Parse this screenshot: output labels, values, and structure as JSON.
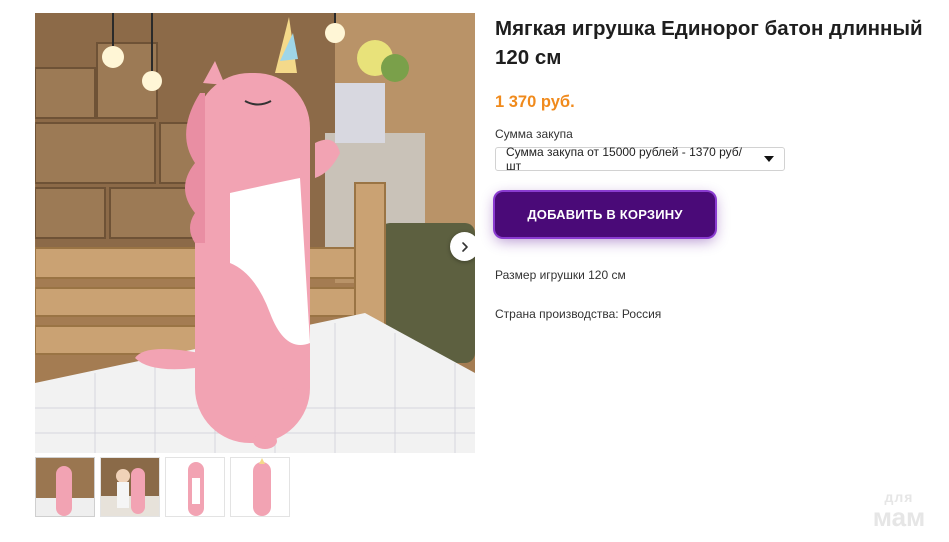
{
  "product": {
    "title": "Мягкая игрушка Единорог батон длинный 120 см",
    "price": "1 370 руб.",
    "purchase_label": "Сумма закупа",
    "purchase_selected": "Сумма закупа от 15000 рублей - 1370 руб/шт",
    "add_to_cart": "ДОБАВИТЬ В КОРЗИНУ",
    "spec_size": "Размер игрушки 120 см",
    "spec_country": "Страна производства: Россия"
  },
  "gallery": {
    "main_image": "pink-unicorn-pillow-photo",
    "next_icon": "chevron-right-icon",
    "thumbnails": [
      "unicorn-on-bed",
      "unicorn-with-child",
      "unicorn-front-white",
      "unicorn-side-white"
    ]
  },
  "watermark": {
    "line1": "для",
    "line2": "мам"
  },
  "colors": {
    "accent": "#4a0a78",
    "price": "#f08a1c"
  }
}
